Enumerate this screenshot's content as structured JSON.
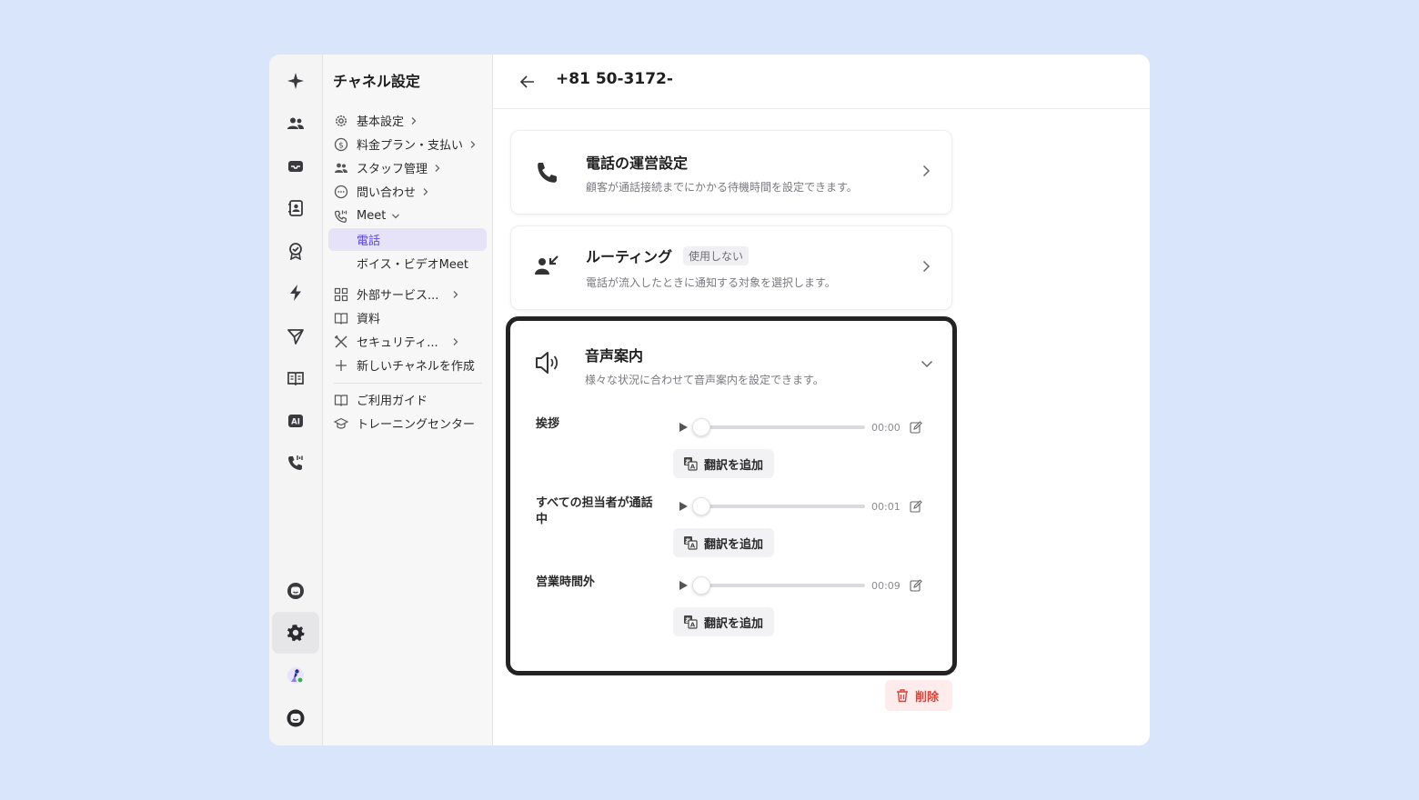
{
  "sidebar": {
    "title": "チャネル設定",
    "items": [
      {
        "label": "基本設定",
        "icon": "gear-icon"
      },
      {
        "label": "料金プラン・支払い",
        "icon": "dollar-circle-icon"
      },
      {
        "label": "スタッフ管理",
        "icon": "users-icon"
      },
      {
        "label": "問い合わせ",
        "icon": "chat-bubble-icon"
      },
      {
        "label": "Meet",
        "icon": "phone-wave-icon"
      },
      {
        "label": "電話"
      },
      {
        "label": "ボイス・ビデオMeet"
      },
      {
        "label": "外部サービス...",
        "icon": "apps-grid-icon"
      },
      {
        "label": "資料",
        "icon": "book-icon"
      },
      {
        "label": "セキュリティ...",
        "icon": "tools-icon"
      },
      {
        "label": "新しいチャネルを作成",
        "icon": "plus-icon"
      },
      {
        "label": "ご利用ガイド",
        "icon": "book-icon"
      },
      {
        "label": "トレーニングセンター",
        "icon": "graduation-cap-icon"
      }
    ]
  },
  "header": {
    "title": "+81 50-3172-"
  },
  "cards": {
    "operation": {
      "title": "電話の運営設定",
      "description": "顧客が通話接続までにかかる待機時間を設定できます。"
    },
    "routing": {
      "title": "ルーティング",
      "badge": "使用しない",
      "description": "電話が流入したときに通知する対象を選択します。"
    },
    "voice": {
      "title": "音声案内",
      "description": "様々な状況に合わせて音声案内を設定できます。",
      "rows": [
        {
          "label": "挨拶",
          "time": "00:00",
          "progress": 0
        },
        {
          "label": "すべての担当者が通話中",
          "time": "00:01",
          "progress": 0
        },
        {
          "label": "営業時間外",
          "time": "00:09",
          "progress": 0
        }
      ],
      "translate_label": "翻訳を追加"
    }
  },
  "delete_label": "削除",
  "colors": {
    "accent": "#5b48d9",
    "danger": "#d9433a",
    "background": "#d8e5fb"
  }
}
